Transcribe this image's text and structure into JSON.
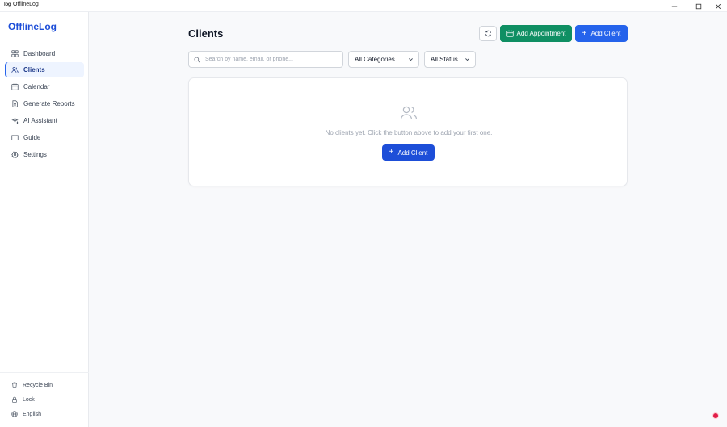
{
  "window": {
    "app_icon_text": "log",
    "title": "OfflineLog"
  },
  "sidebar": {
    "brand": "OfflineLog",
    "items": [
      {
        "label": "Dashboard",
        "icon": "dashboard-icon"
      },
      {
        "label": "Clients",
        "icon": "users-icon",
        "active": true
      },
      {
        "label": "Calendar",
        "icon": "calendar-icon"
      },
      {
        "label": "Generate Reports",
        "icon": "report-icon"
      },
      {
        "label": "AI Assistant",
        "icon": "sparkles-icon"
      },
      {
        "label": "Guide",
        "icon": "book-icon"
      },
      {
        "label": "Settings",
        "icon": "gear-icon"
      }
    ],
    "bottom": [
      {
        "label": "Recycle Bin",
        "icon": "trash-icon"
      },
      {
        "label": "Lock",
        "icon": "lock-icon"
      },
      {
        "label": "English",
        "icon": "globe-icon"
      }
    ]
  },
  "header": {
    "title": "Clients",
    "add_appointment": "Add Appointment",
    "add_client": "Add Client"
  },
  "filters": {
    "search_placeholder": "Search by name, email, or phone...",
    "search_value": "",
    "category": "All Categories",
    "status": "All Status"
  },
  "empty_state": {
    "message": "No clients yet. Click the button above to add your first one.",
    "button": "Add Client"
  },
  "colors": {
    "brand": "#1d4ed8",
    "primary": "#2563eb",
    "success": "#0f8f63",
    "active_bg": "#eef4ff"
  }
}
